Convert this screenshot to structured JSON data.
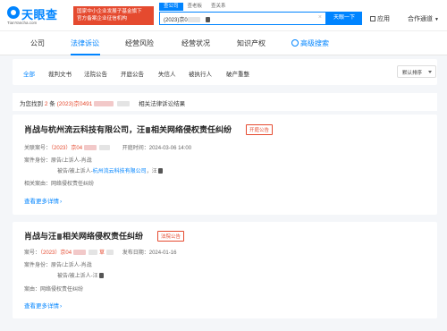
{
  "header": {
    "logo_text": "天眼查",
    "logo_url": "TianYancha.com",
    "promo_line1": "国家中小企业发展子基金旗下",
    "promo_line2": "官方备案企业征信机构",
    "search_tabs": [
      "查公司",
      "查老板",
      "查关系"
    ],
    "search_value": "(2023)京0",
    "search_button": "天眼一下",
    "apps": "应用",
    "coop": "合作通道"
  },
  "nav": {
    "items": [
      "公司",
      "法律诉讼",
      "经营风险",
      "经营状况",
      "知识产权",
      "高级搜索"
    ]
  },
  "filter": {
    "items": [
      "全部",
      "裁判文书",
      "法院公告",
      "开庭公告",
      "失信人",
      "被执行人",
      "破产重整"
    ],
    "sort": "默认排序"
  },
  "summary": {
    "prefix": "为您找到",
    "count": "2",
    "unit": "条",
    "case_no": "(2023)京0491",
    "suffix": "相关法律诉讼结果"
  },
  "cards": [
    {
      "title": "肖战与杭州流云科技有限公司，汪",
      "title_suffix": "相关网络侵权责任纠纷",
      "tag": "开庭公告",
      "case_label": "关联案号：",
      "case_no": "（2023）京04",
      "date_label": "开庭时间：",
      "date": "2024-03-06 14:00",
      "role_label": "案件身份：",
      "role_line1": "原告/上诉人-肖战",
      "role_line2_prefix": "被告/被上诉人-",
      "role_line2_company": "杭州流云科技有限公司",
      "role_line2_sep": "，汪",
      "reason_label": "相关案由：",
      "reason": "网络侵权责任纠纷",
      "more": "查看更多详情"
    },
    {
      "title_prefix": "肖战与汪",
      "title": "相关网络侵权责任纠纷",
      "tag": "法院公告",
      "case_label": "案号：",
      "case_no": "（2023）京04",
      "case_no_tail": "草",
      "date_label": "发布日期：",
      "date": "2024-01-16",
      "role_label": "案件身份：",
      "role_line1": "原告/上诉人-肖战",
      "role_line2": "被告/被上诉人-汪",
      "reason_label": "案由：",
      "reason": "网络侵权责任纠纷",
      "more": "查看更多详情"
    }
  ]
}
